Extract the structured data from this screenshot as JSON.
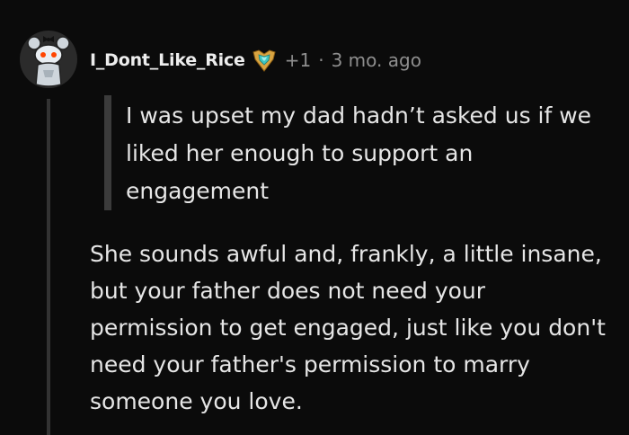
{
  "comment": {
    "username": "I_Dont_Like_Rice",
    "score": "+1",
    "separator": "·",
    "time": "3 mo. ago",
    "avatar_icon": "snoo-avatar-icon",
    "flair_icon": "achievement-badge-icon",
    "quote": "I was upset my dad hadn’t asked us if we liked her enough to support an engagement",
    "body": "She sounds awful and, frankly, a little insane, but your father does not need your permission to get engaged, just like you don't need your father's permission to marry someone you love."
  },
  "colors": {
    "background": "#0b0b0b",
    "text": "#e6e6e6",
    "meta": "#8e8e8e",
    "thread_line": "#333333",
    "quote_bar": "#3b3b3b",
    "flair_gold": "#d9a441",
    "flair_teal": "#3fc7c2"
  }
}
